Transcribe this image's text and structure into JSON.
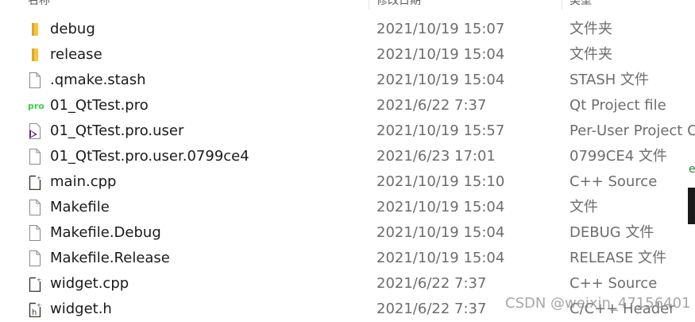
{
  "header": {
    "stub1": "名称",
    "stub2": "修改日期",
    "stub3": "类型"
  },
  "files": [
    {
      "icon": "folder-icon",
      "name": "debug",
      "date": "2021/10/19 15:07",
      "type": "文件夹"
    },
    {
      "icon": "folder-icon",
      "name": "release",
      "date": "2021/10/19 15:04",
      "type": "文件夹"
    },
    {
      "icon": "file-icon",
      "name": ".qmake.stash",
      "date": "2021/10/19 15:04",
      "type": "STASH 文件"
    },
    {
      "icon": "qt-pro-icon",
      "name": "01_QtTest.pro",
      "date": "2021/6/22 7:37",
      "type": "Qt Project file"
    },
    {
      "icon": "vs-user-icon",
      "name": "01_QtTest.pro.user",
      "date": "2021/10/19 15:57",
      "type": "Per-User Project Cs"
    },
    {
      "icon": "file-icon",
      "name": "01_QtTest.pro.user.0799ce4",
      "date": "2021/6/23 17:01",
      "type": "0799CE4 文件"
    },
    {
      "icon": "cpp-file-icon",
      "name": "main.cpp",
      "date": "2021/10/19 15:10",
      "type": "C++ Source"
    },
    {
      "icon": "file-icon",
      "name": "Makefile",
      "date": "2021/10/19 15:04",
      "type": "文件"
    },
    {
      "icon": "file-icon",
      "name": "Makefile.Debug",
      "date": "2021/10/19 15:04",
      "type": "DEBUG 文件"
    },
    {
      "icon": "file-icon",
      "name": "Makefile.Release",
      "date": "2021/10/19 15:04",
      "type": "RELEASE 文件"
    },
    {
      "icon": "cpp-file-icon",
      "name": "widget.cpp",
      "date": "2021/6/22 7:37",
      "type": "C++ Source"
    },
    {
      "icon": "header-file-icon",
      "name": "widget.h",
      "date": "2021/6/22 7:37",
      "type": "C/C++ Header"
    }
  ],
  "edge_glyph": "e",
  "watermark": "CSDN @weixin_47156401",
  "colors": {
    "folder": "#f5c542",
    "qt": "#41cd52",
    "vs": "#68217a",
    "text": "#1a1a1a",
    "muted": "#6d6d6d"
  }
}
